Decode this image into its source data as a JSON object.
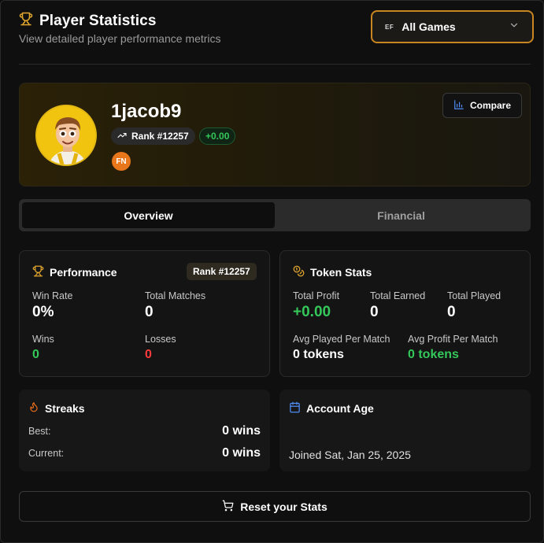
{
  "header": {
    "title": "Player Statistics",
    "subtitle": "View detailed player performance metrics",
    "game_select": {
      "icon_text": "EF",
      "value": "All Games"
    }
  },
  "profile": {
    "username": "1jacob9",
    "rank": "Rank #12257",
    "delta": "+0.00",
    "game_badge": "FN",
    "compare_label": "Compare"
  },
  "tabs": [
    {
      "label": "Overview",
      "active": true
    },
    {
      "label": "Financial",
      "active": false
    }
  ],
  "performance": {
    "title": "Performance",
    "rank": "Rank #12257",
    "win_rate_label": "Win Rate",
    "win_rate": "0%",
    "total_matches_label": "Total Matches",
    "total_matches": "0",
    "wins_label": "Wins",
    "wins": "0",
    "losses_label": "Losses",
    "losses": "0"
  },
  "token_stats": {
    "title": "Token Stats",
    "total_profit_label": "Total Profit",
    "total_profit": "+0.00",
    "total_earned_label": "Total Earned",
    "total_earned": "0",
    "total_played_label": "Total Played",
    "total_played": "0",
    "avg_played_label": "Avg Played Per Match",
    "avg_played": "0 tokens",
    "avg_profit_label": "Avg Profit Per Match",
    "avg_profit": "0 tokens"
  },
  "streaks": {
    "title": "Streaks",
    "best_label": "Best:",
    "best": "0 wins",
    "current_label": "Current:",
    "current": "0 wins"
  },
  "account_age": {
    "title": "Account Age",
    "joined": "Joined Sat, Jan 25, 2025"
  },
  "reset_label": "Reset your Stats",
  "colors": {
    "accent": "#c9851f",
    "positive": "#34c759",
    "negative": "#ff3b3b",
    "trophy": "#e3a72f",
    "flame": "#f0701a",
    "calendar": "#4f8ef7"
  }
}
